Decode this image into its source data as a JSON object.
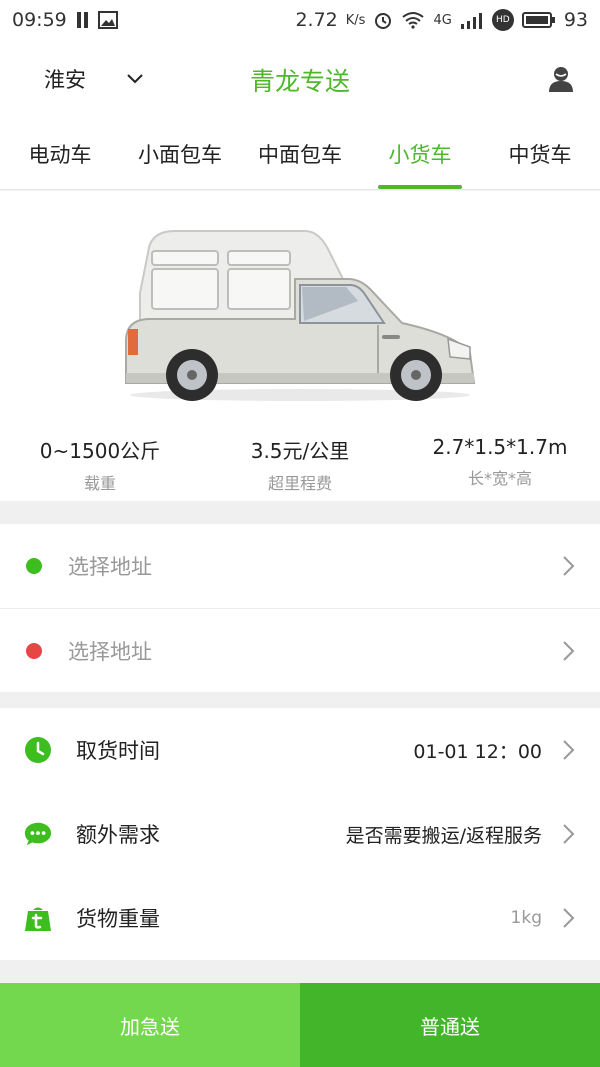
{
  "status_bar": {
    "time": "09:59",
    "speed": "2.72",
    "speed_unit": "K/s",
    "network": "4G",
    "hd": "HD",
    "battery": "93"
  },
  "header": {
    "city": "淮安",
    "title": "青龙专送"
  },
  "tabs": [
    {
      "label": "电动车"
    },
    {
      "label": "小面包车"
    },
    {
      "label": "中面包车"
    },
    {
      "label": "小货车"
    },
    {
      "label": "中货车"
    }
  ],
  "active_tab": 3,
  "vehicle": {
    "specs": [
      {
        "value": "0~1500公斤",
        "label": "载重"
      },
      {
        "value": "3.5元/公里",
        "label": "超里程费"
      },
      {
        "value": "2.7*1.5*1.7m",
        "label": "长*宽*高"
      }
    ]
  },
  "addresses": {
    "pickup_placeholder": "选择地址",
    "dropoff_placeholder": "选择地址",
    "pickup_color": "#3ebd1f",
    "dropoff_color": "#e84545"
  },
  "options": {
    "pickup_time": {
      "label": "取货时间",
      "value": "01-01 12：00"
    },
    "extra": {
      "label": "额外需求",
      "value": "是否需要搬运/返程服务"
    },
    "weight": {
      "label": "货物重量",
      "value": "1kg"
    }
  },
  "actions": {
    "urgent": "加急送",
    "normal": "普通送"
  },
  "colors": {
    "brand_green": "#4cb82a",
    "urgent_button": "#73d84d",
    "normal_button": "#42b52a"
  }
}
